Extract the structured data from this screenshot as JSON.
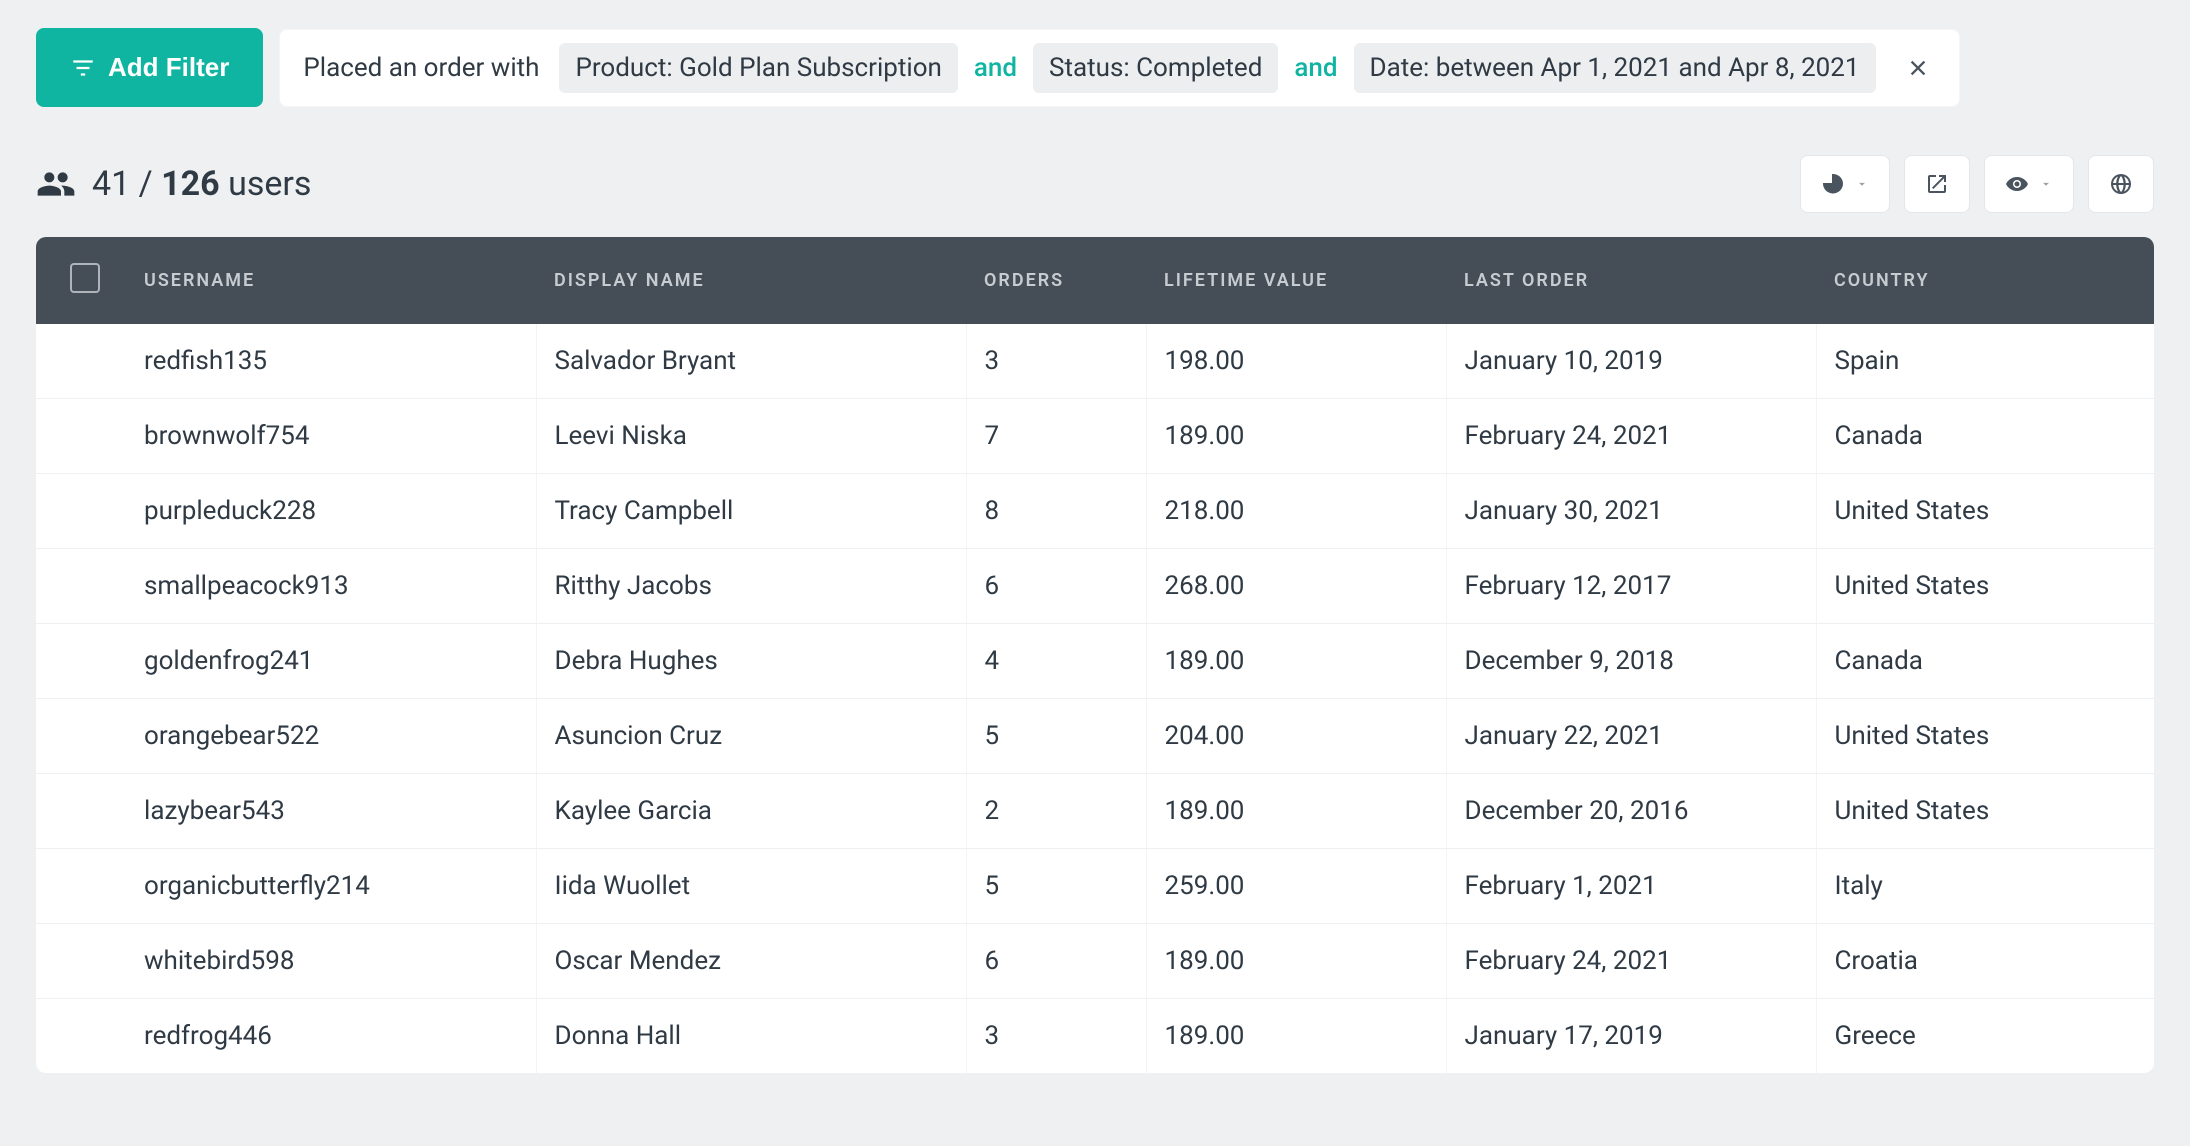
{
  "filter": {
    "add_button_label": "Add Filter",
    "prefix": "Placed an order with",
    "joiner": "and",
    "chips": [
      "Product: Gold Plan Subscription",
      "Status: Completed",
      "Date: between Apr 1, 2021 and Apr 8, 2021"
    ]
  },
  "summary": {
    "current": "41",
    "separator": "/",
    "total": "126",
    "noun": "users"
  },
  "columns": {
    "username": "USERNAME",
    "display_name": "DISPLAY NAME",
    "orders": "ORDERS",
    "lifetime_value": "LIFETIME VALUE",
    "last_order": "LAST ORDER",
    "country": "COUNTRY"
  },
  "rows": [
    {
      "username": "redfish135",
      "display_name": "Salvador Bryant",
      "orders": "3",
      "lifetime_value": "198.00",
      "last_order": "January 10, 2019",
      "country": "Spain"
    },
    {
      "username": "brownwolf754",
      "display_name": "Leevi Niska",
      "orders": "7",
      "lifetime_value": "189.00",
      "last_order": "February 24, 2021",
      "country": "Canada"
    },
    {
      "username": "purpleduck228",
      "display_name": "Tracy Campbell",
      "orders": "8",
      "lifetime_value": "218.00",
      "last_order": "January 30, 2021",
      "country": "United States"
    },
    {
      "username": "smallpeacock913",
      "display_name": "Ritthy Jacobs",
      "orders": "6",
      "lifetime_value": "268.00",
      "last_order": "February 12, 2017",
      "country": "United States"
    },
    {
      "username": "goldenfrog241",
      "display_name": "Debra Hughes",
      "orders": "4",
      "lifetime_value": "189.00",
      "last_order": "December 9, 2018",
      "country": "Canada"
    },
    {
      "username": "orangebear522",
      "display_name": "Asuncion Cruz",
      "orders": "5",
      "lifetime_value": "204.00",
      "last_order": "January 22, 2021",
      "country": "United States"
    },
    {
      "username": "lazybear543",
      "display_name": "Kaylee Garcia",
      "orders": "2",
      "lifetime_value": "189.00",
      "last_order": "December 20, 2016",
      "country": "United States"
    },
    {
      "username": "organicbutterfly214",
      "display_name": "Iida Wuollet",
      "orders": "5",
      "lifetime_value": "259.00",
      "last_order": "February 1, 2021",
      "country": "Italy"
    },
    {
      "username": "whitebird598",
      "display_name": "Oscar Mendez",
      "orders": "6",
      "lifetime_value": "189.00",
      "last_order": "February 24, 2021",
      "country": "Croatia"
    },
    {
      "username": "redfrog446",
      "display_name": "Donna Hall",
      "orders": "3",
      "lifetime_value": "189.00",
      "last_order": "January 17, 2019",
      "country": "Greece"
    }
  ]
}
